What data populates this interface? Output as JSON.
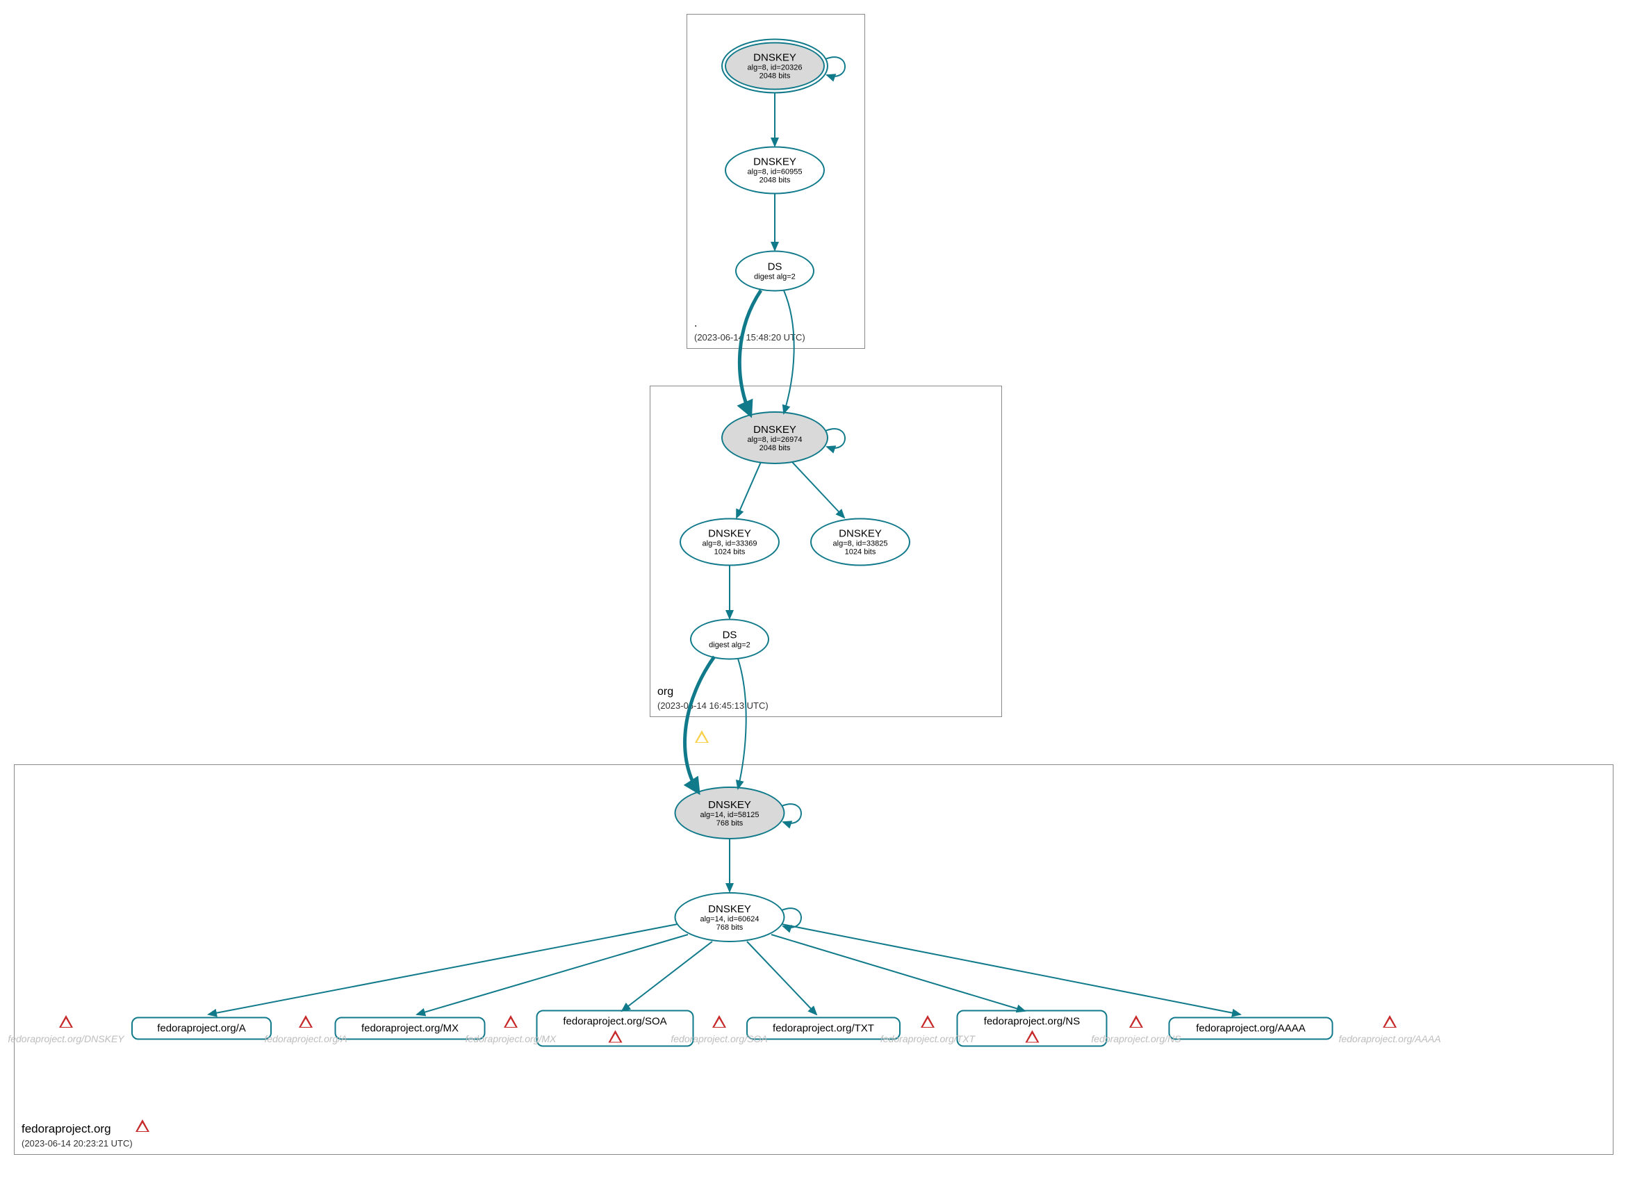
{
  "zones": {
    "root": {
      "label": ".",
      "timestamp": "(2023-06-14 15:48:20 UTC)",
      "nodes": {
        "ksk": {
          "title": "DNSKEY",
          "line2": "alg=8, id=20326",
          "line3": "2048 bits"
        },
        "zsk": {
          "title": "DNSKEY",
          "line2": "alg=8, id=60955",
          "line3": "2048 bits"
        },
        "ds": {
          "title": "DS",
          "line2": "digest alg=2"
        }
      }
    },
    "org": {
      "label": "org",
      "timestamp": "(2023-06-14 16:45:13 UTC)",
      "nodes": {
        "ksk": {
          "title": "DNSKEY",
          "line2": "alg=8, id=26974",
          "line3": "2048 bits"
        },
        "zsk1": {
          "title": "DNSKEY",
          "line2": "alg=8, id=33369",
          "line3": "1024 bits"
        },
        "zsk2": {
          "title": "DNSKEY",
          "line2": "alg=8, id=33825",
          "line3": "1024 bits"
        },
        "ds": {
          "title": "DS",
          "line2": "digest alg=2"
        }
      }
    },
    "fedora": {
      "label": "fedoraproject.org",
      "timestamp": "(2023-06-14 20:23:21 UTC)",
      "nodes": {
        "ksk": {
          "title": "DNSKEY",
          "line2": "alg=14, id=58125",
          "line3": "768 bits"
        },
        "zsk": {
          "title": "DNSKEY",
          "line2": "alg=14, id=60624",
          "line3": "768 bits"
        }
      },
      "records": {
        "a": "fedoraproject.org/A",
        "mx": "fedoraproject.org/MX",
        "soa": "fedoraproject.org/SOA",
        "txt": "fedoraproject.org/TXT",
        "ns": "fedoraproject.org/NS",
        "aaaa": "fedoraproject.org/AAAA"
      },
      "ghosts": {
        "dnskey": "fedoraproject.org/DNSKEY",
        "a": "fedoraproject.org/A",
        "mx": "fedoraproject.org/MX",
        "soa": "fedoraproject.org/SOA",
        "txt": "fedoraproject.org/TXT",
        "ns": "fedoraproject.org/NS",
        "aaaa": "fedoraproject.org/AAAA"
      }
    }
  }
}
